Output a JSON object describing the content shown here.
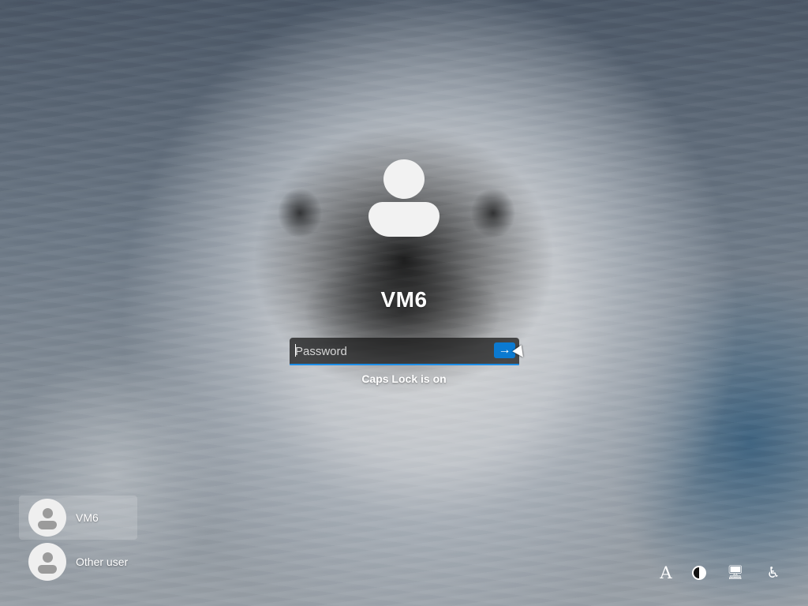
{
  "login": {
    "username": "VM6",
    "password_placeholder": "Password",
    "submit_icon": "arrow-right-icon",
    "caps_lock_message": "Caps Lock is on"
  },
  "users": [
    {
      "label": "VM6",
      "selected": true
    },
    {
      "label": "Other user",
      "selected": false
    }
  ],
  "system_controls": {
    "language_label": "A",
    "accessibility_contrast_icon": "contrast-icon",
    "network_icon": "network-icon",
    "accessibility_icon": "accessibility-icon"
  },
  "colors": {
    "accent": "#1c8ee8",
    "submit_button": "#0b7ad1",
    "text": "#ffffff"
  }
}
